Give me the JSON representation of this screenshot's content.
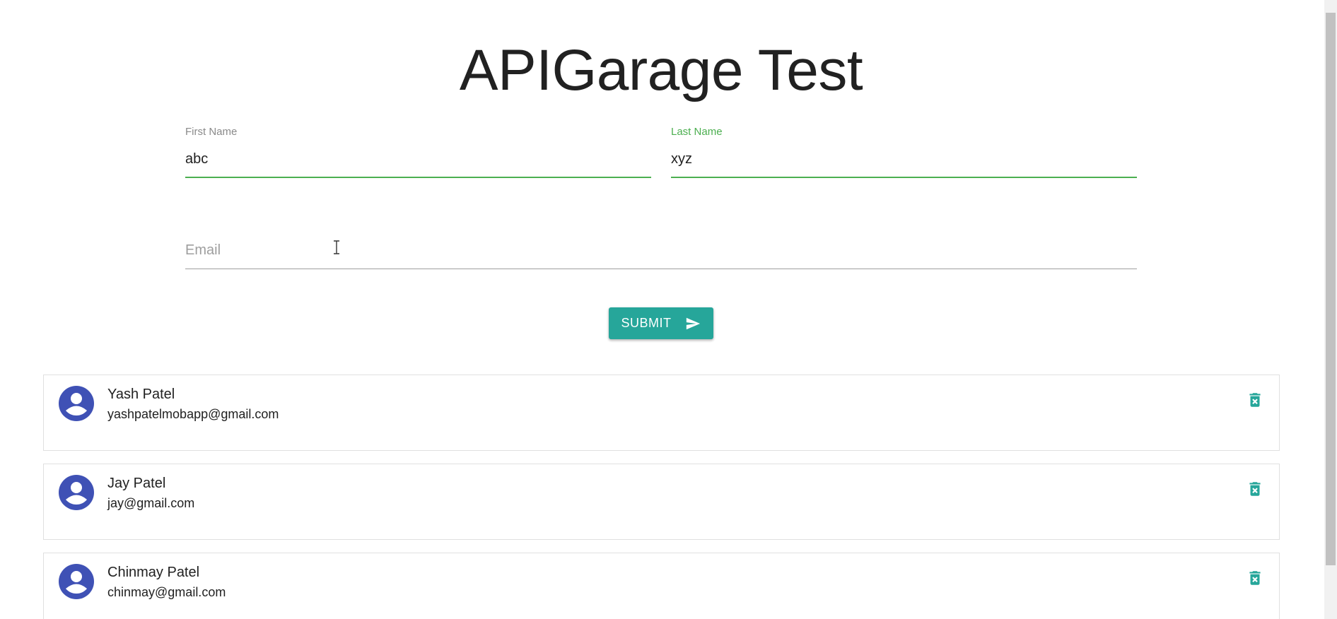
{
  "header": {
    "title": "APIGarage Test"
  },
  "form": {
    "first_name": {
      "label": "First Name",
      "value": "abc"
    },
    "last_name": {
      "label": "Last Name",
      "value": "xyz"
    },
    "email": {
      "placeholder": "Email",
      "value": ""
    },
    "submit_label": "SUBMIT"
  },
  "users": [
    {
      "name": "Yash Patel",
      "email": "yashpatelmobapp@gmail.com"
    },
    {
      "name": "Jay Patel",
      "email": "jay@gmail.com"
    },
    {
      "name": "Chinmay Patel",
      "email": "chinmay@gmail.com"
    }
  ],
  "colors": {
    "accent_teal": "#26a69a",
    "focus_green": "#4caf50",
    "avatar_indigo": "#3f51b5",
    "text": "#212121"
  },
  "icons": {
    "submit": "send-icon",
    "avatar": "account-circle-icon",
    "delete": "delete-forever-icon",
    "cursor": "text-cursor-icon"
  }
}
